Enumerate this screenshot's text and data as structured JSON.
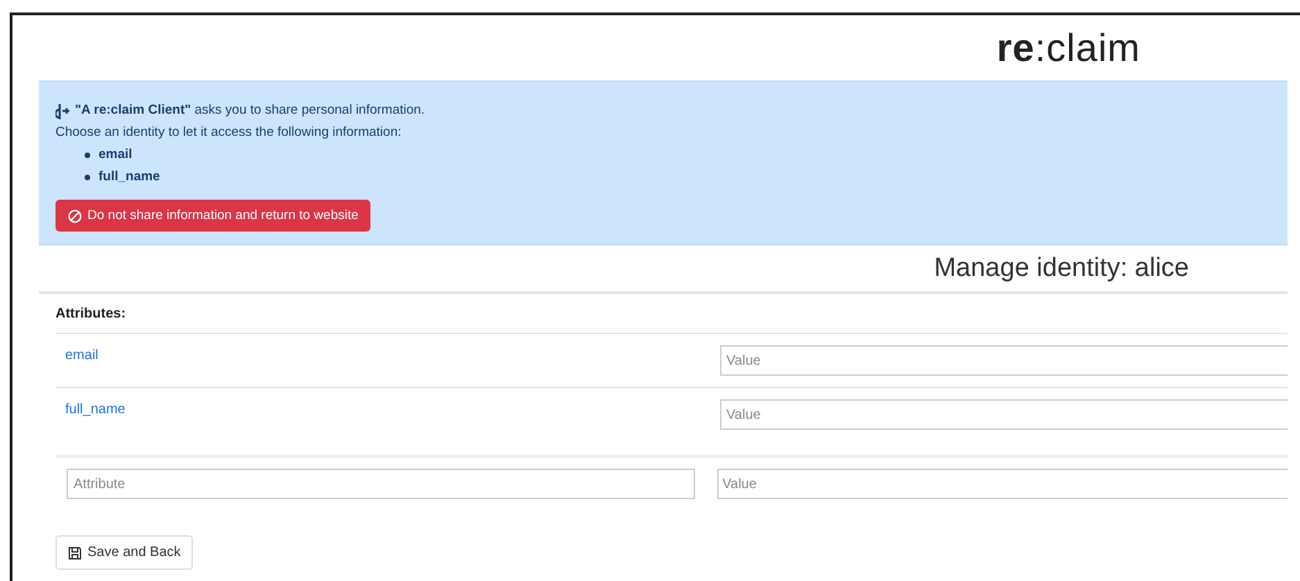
{
  "logo": "**re**:claim",
  "request": {
    "intro": "**\"A re:claim Client\"** asks you to share personal information.",
    "prompt": "Choose an identity to let it access the following information:",
    "items": [
      "email",
      "full_name"
    ]
  },
  "deny_button": "Do not share information and return to website",
  "heading": "Manage identity: alice",
  "attributes_label": "Attributes:",
  "attributes": [
    {
      "name": "email",
      "value_placeholder": "Value"
    },
    {
      "name": "full_name",
      "value_placeholder": "Value"
    }
  ],
  "new_attribute": {
    "name_placeholder": "Attribute",
    "value_placeholder": "Value"
  },
  "save_button": "Save and Back"
}
